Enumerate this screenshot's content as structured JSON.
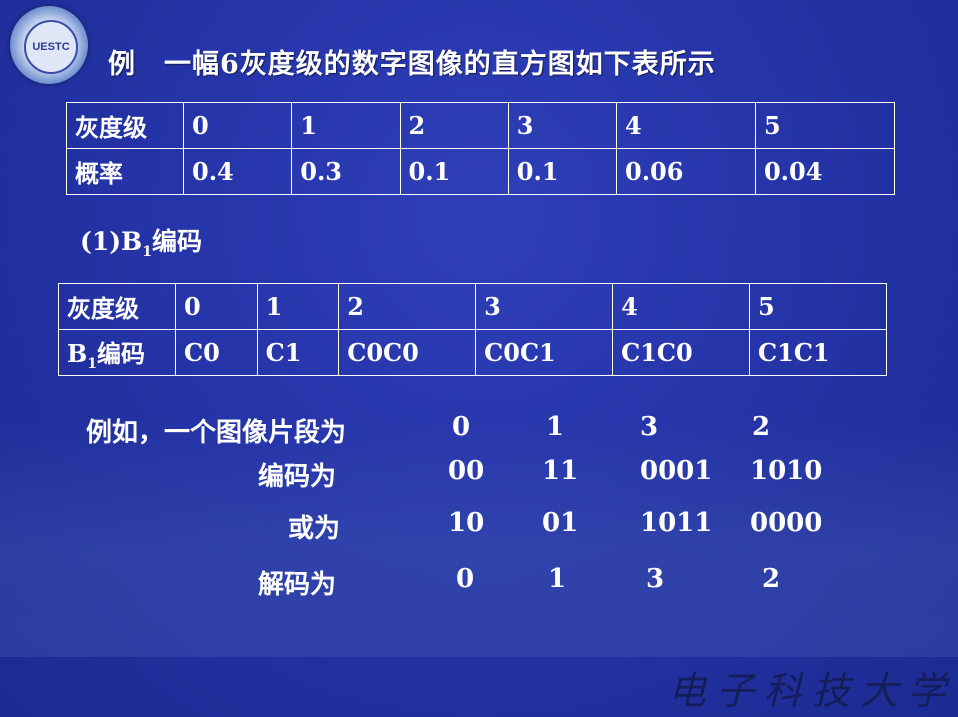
{
  "logo": {
    "text": "UESTC"
  },
  "title": "例　一幅6灰度级的数字图像的直方图如下表所示",
  "table1": {
    "rows": [
      [
        "灰度级",
        "0",
        "1",
        "2",
        "3",
        "4",
        "5"
      ],
      [
        "概率",
        "0.4",
        "0.3",
        "0.1",
        "0.1",
        "0.06",
        "0.04"
      ]
    ]
  },
  "subtitle": {
    "prefix": "(1)B",
    "sub": "1",
    "suffix": "编码"
  },
  "table2": {
    "header": [
      "灰度级",
      "0",
      "1",
      "2",
      "3",
      "4",
      "5"
    ],
    "row_label_prefix": "B",
    "row_label_sub": "1",
    "row_label_suffix": "编码",
    "row": [
      "C0",
      "C1",
      "C0C0",
      "C0C1",
      "C1C0",
      "C1C1"
    ]
  },
  "example": {
    "label": "例如，一个图像片段为",
    "segment": [
      "0",
      "1",
      "3",
      "2"
    ],
    "encode_label": "编码为",
    "encode": [
      "00",
      "11",
      "0001",
      "1010"
    ],
    "or_label": "或为",
    "or": [
      "10",
      "01",
      "1011",
      "0000"
    ],
    "decode_label": "解码为",
    "decode": [
      "0",
      "1",
      "3",
      "2"
    ]
  },
  "footer": {
    "institution": "电子科技大学"
  }
}
